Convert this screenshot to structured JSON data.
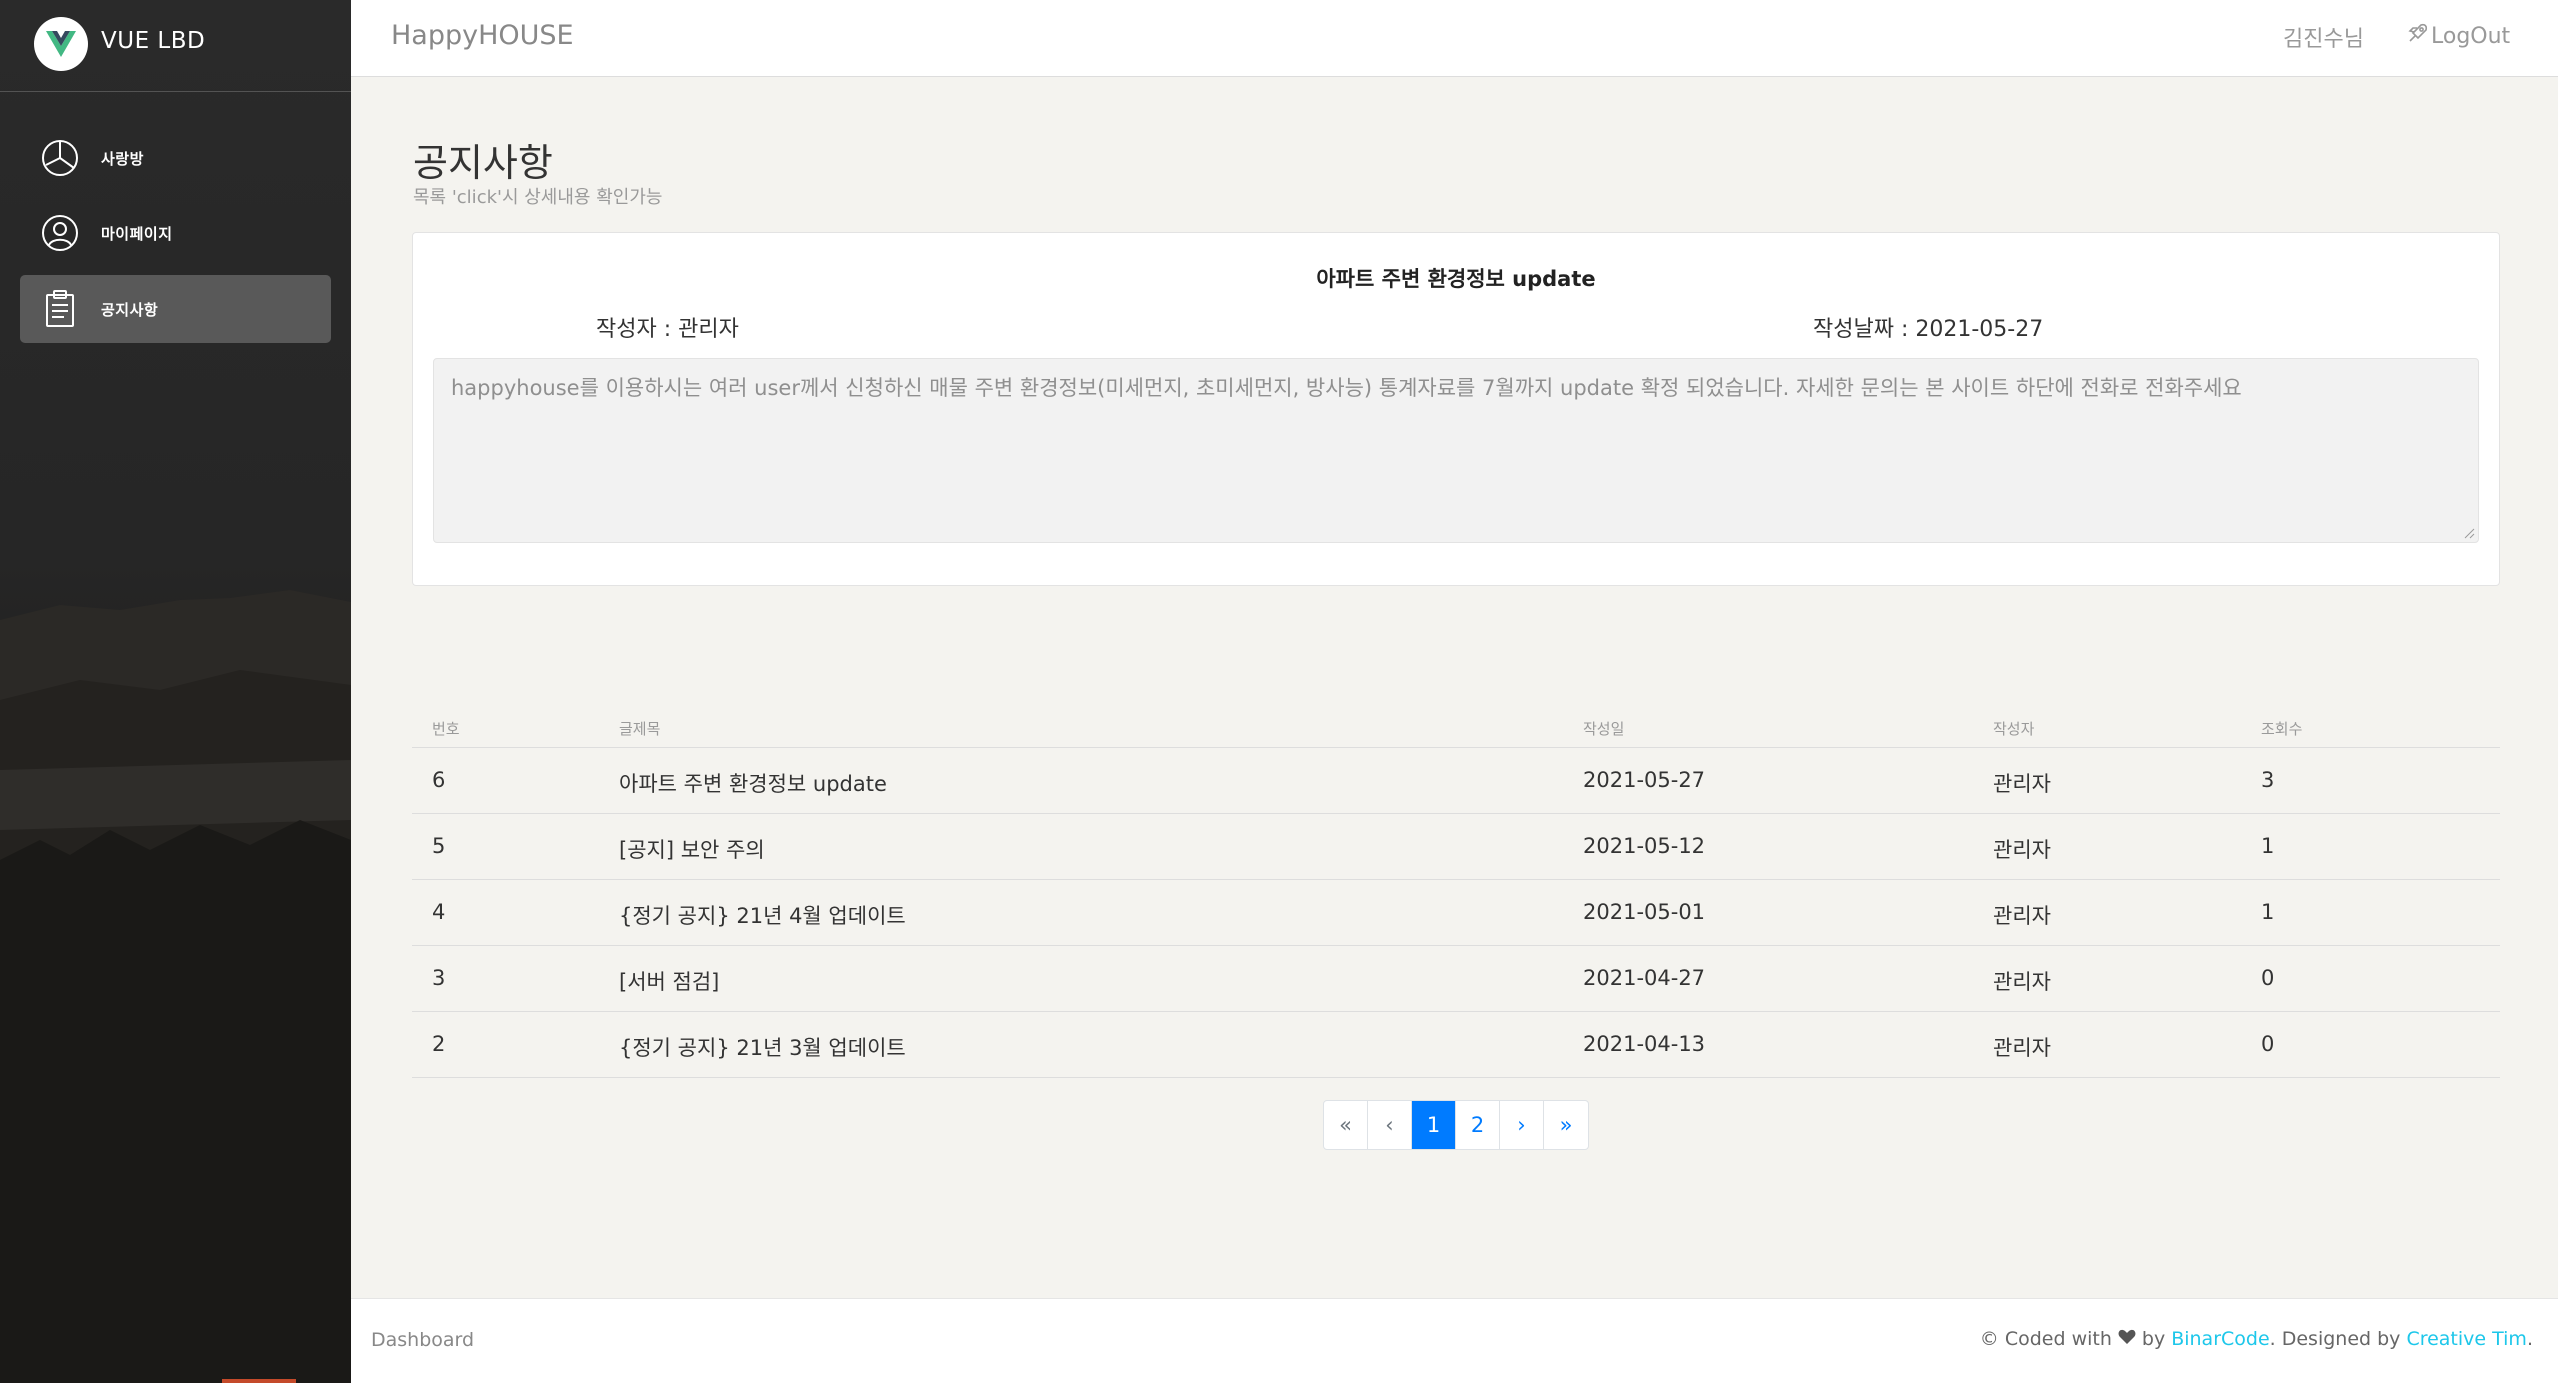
{
  "sidebar": {
    "brand": "VUE LBD",
    "items": [
      {
        "label": "사랑방",
        "icon": "pie-chart-icon"
      },
      {
        "label": "마이페이지",
        "icon": "user-circle-icon"
      },
      {
        "label": "공지사항",
        "icon": "clipboard-icon"
      }
    ]
  },
  "navbar": {
    "title": "HappyHOUSE",
    "user": "김진수님",
    "logout": "LogOut"
  },
  "header": {
    "title": "공지사항",
    "subtitle": "목록 'click'시 상세내용 확인가능"
  },
  "detail": {
    "title": "아파트 주변 환경정보 update",
    "author": "작성자 : 관리자",
    "date": "작성날짜 : 2021-05-27",
    "content": "happyhouse를 이용하시는 여러 user께서 신청하신 매물 주변 환경정보(미세먼지, 초미세먼지, 방사능) 통계자료를 7월까지 update 확정 되었습니다. 자세한 문의는 본 사이트 하단에 전화로 전화주세요"
  },
  "table": {
    "headers": [
      "번호",
      "글제목",
      "작성일",
      "작성자",
      "조회수"
    ],
    "rows": [
      {
        "no": "6",
        "title": "아파트 주변 환경정보 update",
        "date": "2021-05-27",
        "author": "관리자",
        "views": "3"
      },
      {
        "no": "5",
        "title": "[공지] 보안 주의",
        "date": "2021-05-12",
        "author": "관리자",
        "views": "1"
      },
      {
        "no": "4",
        "title": "{정기 공지} 21년 4월 업데이트",
        "date": "2021-05-01",
        "author": "관리자",
        "views": "1"
      },
      {
        "no": "3",
        "title": "[서버 점검]",
        "date": "2021-04-27",
        "author": "관리자",
        "views": "0"
      },
      {
        "no": "2",
        "title": "{정기 공지} 21년 3월 업데이트",
        "date": "2021-04-13",
        "author": "관리자",
        "views": "0"
      }
    ]
  },
  "pagination": {
    "first": "«",
    "prev": "‹",
    "pages": [
      "1",
      "2"
    ],
    "active": "1",
    "next": "›",
    "last": "»"
  },
  "footer": {
    "left": "Dashboard",
    "copy": "© Coded with",
    "by": "by",
    "binarcode": "BinarCode",
    "designed": ". Designed by",
    "creative": "Creative Tim",
    "end": "."
  },
  "colors": {
    "accent": "#007bff",
    "link": "#1dc7ea",
    "vue_green": "#42b883",
    "vue_dark": "#35495e"
  }
}
